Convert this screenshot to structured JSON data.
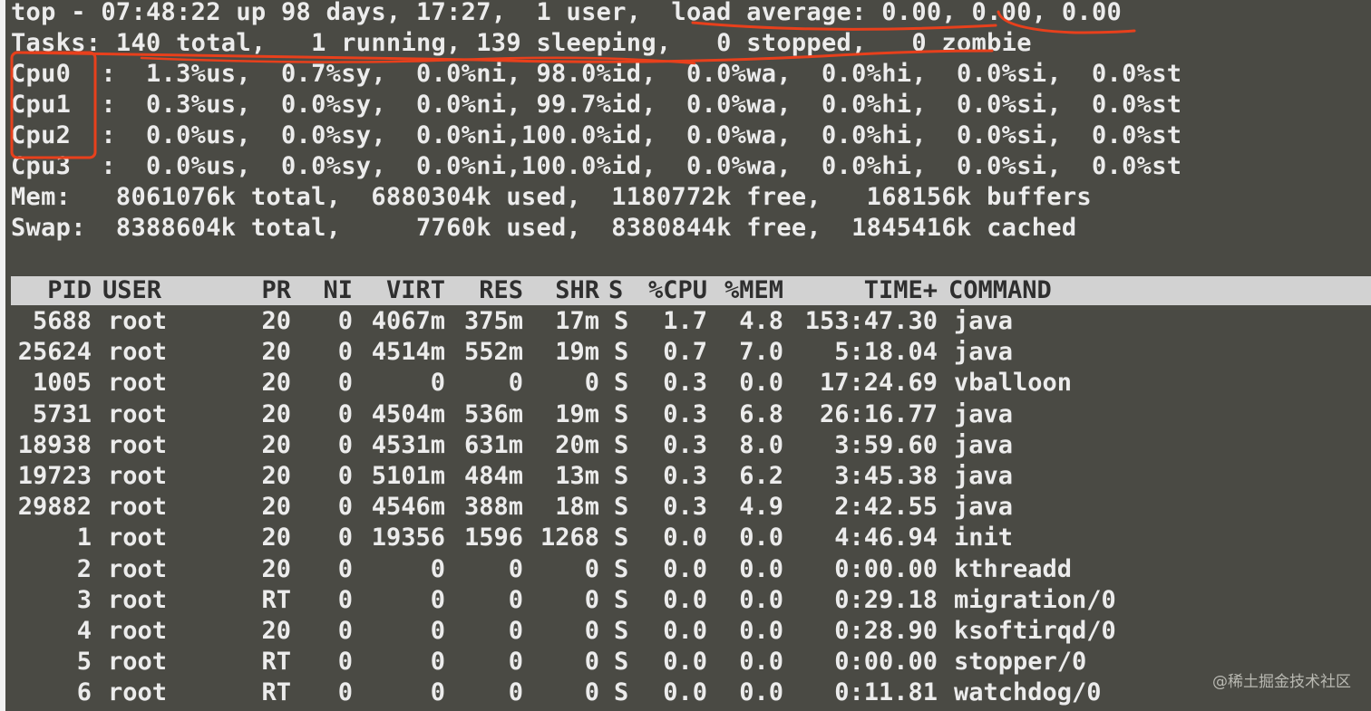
{
  "summary": {
    "top_line": "top - 07:48:22 up 98 days, 17:27,  1 user,  load average: 0.00, 0.00, 0.00",
    "tasks_line": "Tasks: 140 total,   1 running, 139 sleeping,   0 stopped,   0 zombie",
    "cpu_lines": [
      "Cpu0  :  1.3%us,  0.7%sy,  0.0%ni, 98.0%id,  0.0%wa,  0.0%hi,  0.0%si,  0.0%st",
      "Cpu1  :  0.3%us,  0.0%sy,  0.0%ni, 99.7%id,  0.0%wa,  0.0%hi,  0.0%si,  0.0%st",
      "Cpu2  :  0.0%us,  0.0%sy,  0.0%ni,100.0%id,  0.0%wa,  0.0%hi,  0.0%si,  0.0%st",
      "Cpu3  :  0.0%us,  0.0%sy,  0.0%ni,100.0%id,  0.0%wa,  0.0%hi,  0.0%si,  0.0%st"
    ],
    "mem_line": "Mem:   8061076k total,  6880304k used,  1180772k free,   168156k buffers",
    "swap_line": "Swap:  8388604k total,     7760k used,  8380844k free,  1845416k cached"
  },
  "process_table": {
    "headers": {
      "pid": "PID",
      "user": "USER",
      "pr": "PR",
      "ni": "NI",
      "virt": "VIRT",
      "res": "RES",
      "shr": "SHR",
      "s": "S",
      "cpu": "%CPU",
      "mem": "%MEM",
      "time": "TIME+",
      "command": "COMMAND"
    },
    "rows": [
      {
        "pid": "5688",
        "user": "root",
        "pr": "20",
        "ni": "0",
        "virt": "4067m",
        "res": "375m",
        "shr": "17m",
        "s": "S",
        "cpu": "1.7",
        "mem": "4.8",
        "time": "153:47.30",
        "command": "java"
      },
      {
        "pid": "25624",
        "user": "root",
        "pr": "20",
        "ni": "0",
        "virt": "4514m",
        "res": "552m",
        "shr": "19m",
        "s": "S",
        "cpu": "0.7",
        "mem": "7.0",
        "time": "5:18.04",
        "command": "java"
      },
      {
        "pid": "1005",
        "user": "root",
        "pr": "20",
        "ni": "0",
        "virt": "0",
        "res": "0",
        "shr": "0",
        "s": "S",
        "cpu": "0.3",
        "mem": "0.0",
        "time": "17:24.69",
        "command": "vballoon"
      },
      {
        "pid": "5731",
        "user": "root",
        "pr": "20",
        "ni": "0",
        "virt": "4504m",
        "res": "536m",
        "shr": "19m",
        "s": "S",
        "cpu": "0.3",
        "mem": "6.8",
        "time": "26:16.77",
        "command": "java"
      },
      {
        "pid": "18938",
        "user": "root",
        "pr": "20",
        "ni": "0",
        "virt": "4531m",
        "res": "631m",
        "shr": "20m",
        "s": "S",
        "cpu": "0.3",
        "mem": "8.0",
        "time": "3:59.60",
        "command": "java"
      },
      {
        "pid": "19723",
        "user": "root",
        "pr": "20",
        "ni": "0",
        "virt": "5101m",
        "res": "484m",
        "shr": "13m",
        "s": "S",
        "cpu": "0.3",
        "mem": "6.2",
        "time": "3:45.38",
        "command": "java"
      },
      {
        "pid": "29882",
        "user": "root",
        "pr": "20",
        "ni": "0",
        "virt": "4546m",
        "res": "388m",
        "shr": "18m",
        "s": "S",
        "cpu": "0.3",
        "mem": "4.9",
        "time": "2:42.55",
        "command": "java"
      },
      {
        "pid": "1",
        "user": "root",
        "pr": "20",
        "ni": "0",
        "virt": "19356",
        "res": "1596",
        "shr": "1268",
        "s": "S",
        "cpu": "0.0",
        "mem": "0.0",
        "time": "4:46.94",
        "command": "init"
      },
      {
        "pid": "2",
        "user": "root",
        "pr": "20",
        "ni": "0",
        "virt": "0",
        "res": "0",
        "shr": "0",
        "s": "S",
        "cpu": "0.0",
        "mem": "0.0",
        "time": "0:00.00",
        "command": "kthreadd"
      },
      {
        "pid": "3",
        "user": "root",
        "pr": "RT",
        "ni": "0",
        "virt": "0",
        "res": "0",
        "shr": "0",
        "s": "S",
        "cpu": "0.0",
        "mem": "0.0",
        "time": "0:29.18",
        "command": "migration/0"
      },
      {
        "pid": "4",
        "user": "root",
        "pr": "20",
        "ni": "0",
        "virt": "0",
        "res": "0",
        "shr": "0",
        "s": "S",
        "cpu": "0.0",
        "mem": "0.0",
        "time": "0:28.90",
        "command": "ksoftirqd/0"
      },
      {
        "pid": "5",
        "user": "root",
        "pr": "RT",
        "ni": "0",
        "virt": "0",
        "res": "0",
        "shr": "0",
        "s": "S",
        "cpu": "0.0",
        "mem": "0.0",
        "time": "0:00.00",
        "command": "stopper/0"
      },
      {
        "pid": "6",
        "user": "root",
        "pr": "RT",
        "ni": "0",
        "virt": "0",
        "res": "0",
        "shr": "0",
        "s": "S",
        "cpu": "0.0",
        "mem": "0.0",
        "time": "0:11.81",
        "command": "watchdog/0"
      }
    ]
  },
  "watermark": "@稀土掘金技术社区",
  "colors": {
    "terminal_background": "#4a4a44",
    "terminal_text": "#ececec",
    "header_bar": "#d2d2d2",
    "header_text": "#2f2f2f",
    "annotation": "#e8401c"
  }
}
